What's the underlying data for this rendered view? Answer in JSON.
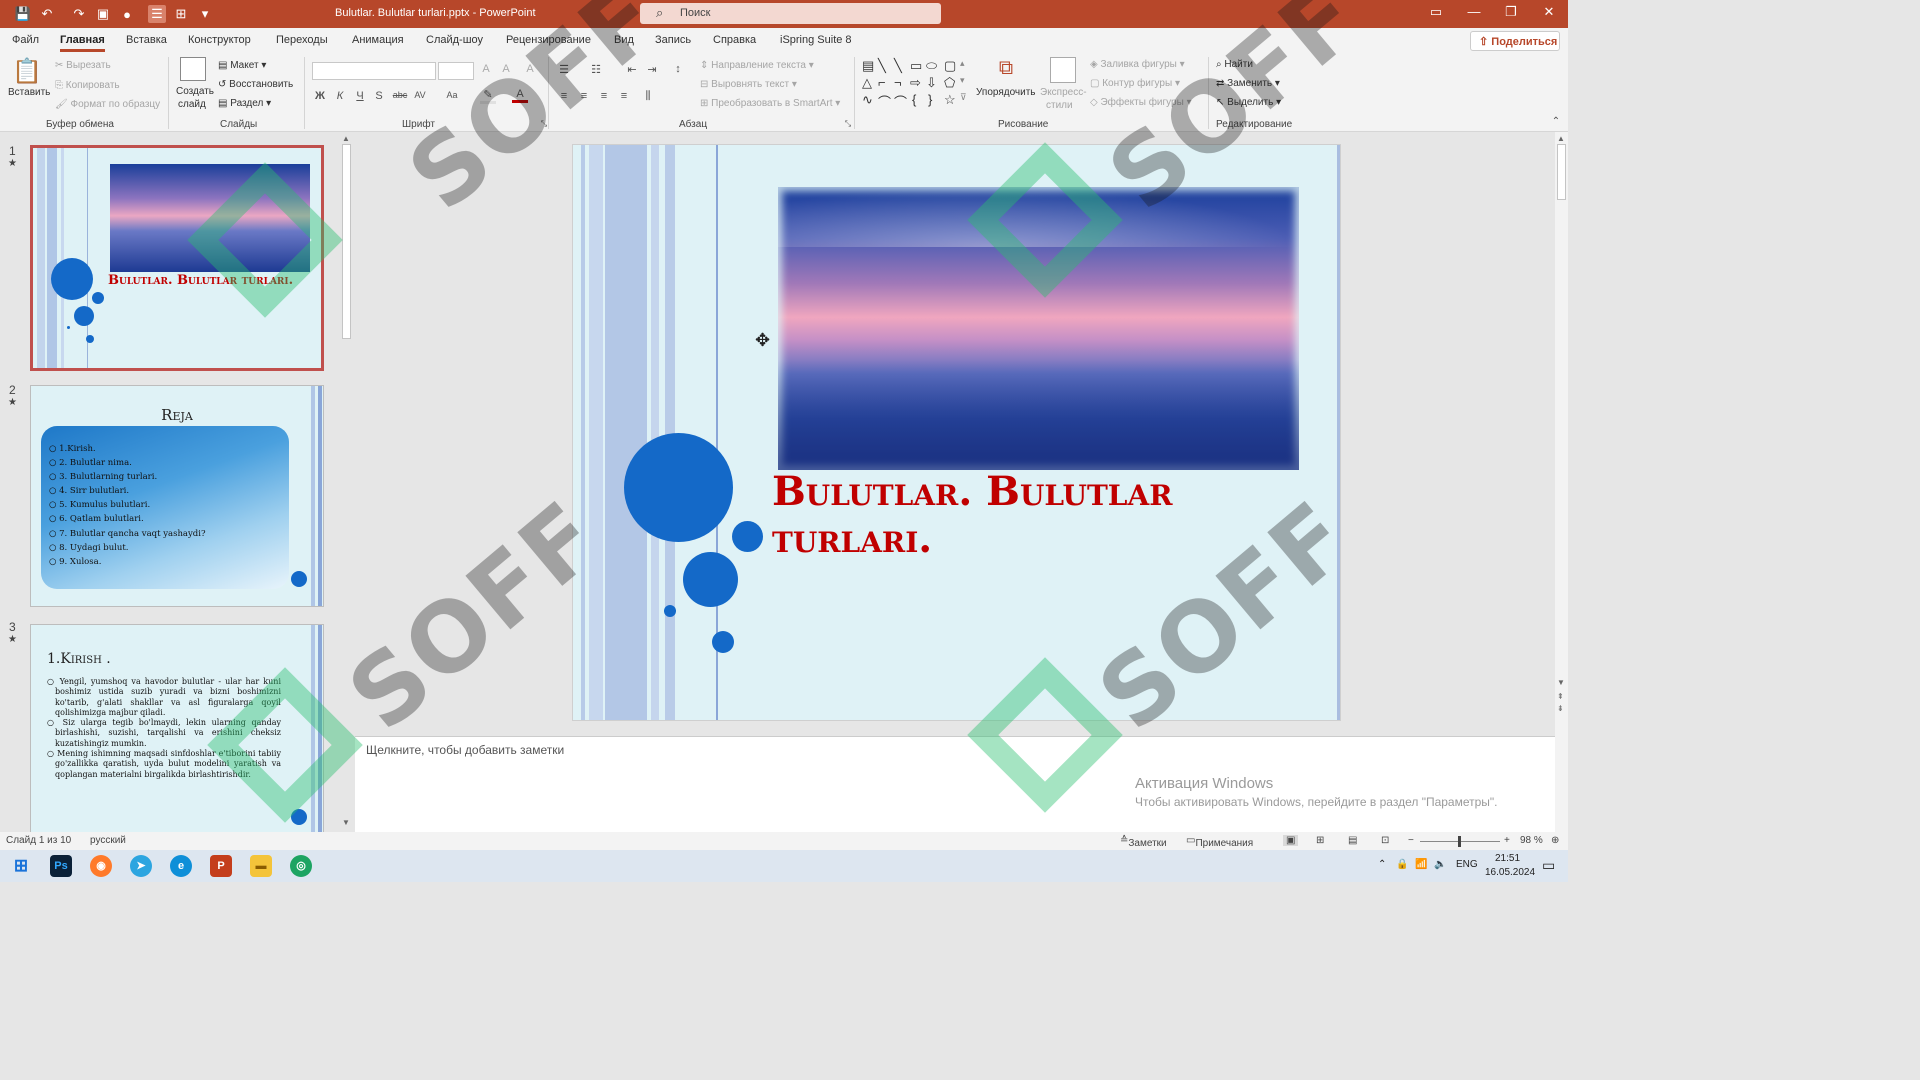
{
  "window": {
    "title": "Bulutlar. Bulutlar turlari.pptx  -  PowerPoint",
    "search_placeholder": "Поиск"
  },
  "menu": [
    "Файл",
    "Главная",
    "Вставка",
    "Конструктор",
    "Переходы",
    "Анимация",
    "Слайд-шоу",
    "Рецензирование",
    "Вид",
    "Запись",
    "Справка",
    "iSpring Suite 8"
  ],
  "share": "Поделиться",
  "ribbon": {
    "clipboard": {
      "paste": "Вставить",
      "cut": "Вырезать",
      "copy": "Копировать",
      "format": "Формат по образцу",
      "group": "Буфер обмена"
    },
    "slides": {
      "new1": "Создать",
      "new2": "слайд",
      "layout": "Макет",
      "reset": "Восстановить",
      "section": "Раздел",
      "group": "Слайды"
    },
    "font": {
      "group": "Шрифт",
      "bold": "Ж",
      "italic": "К",
      "underline": "Ч",
      "shadow": "S",
      "strike": "abc",
      "spacing": "AV",
      "case": "Aa"
    },
    "paragraph": {
      "direction": "Направление текста",
      "align": "Выровнять текст",
      "smartart": "Преобразовать в SmartArt",
      "group": "Абзац"
    },
    "drawing": {
      "arrange": "Упорядочить",
      "styles1": "Экспресс-",
      "styles2": "стили",
      "fill": "Заливка фигуры",
      "outline": "Контур фигуры",
      "effects": "Эффекты фигуры",
      "group": "Рисование"
    },
    "editing": {
      "find": "Найти",
      "replace": "Заменить",
      "select": "Выделить",
      "group": "Редактирование"
    }
  },
  "thumbs": [
    {
      "num": "1",
      "title": "Bulutlar. Bulutlar turlari."
    },
    {
      "num": "2",
      "title": "Reja",
      "items": [
        "1.Kirish.",
        "2. Bulutlar nima.",
        "3. Bulutlarning turlari.",
        "4. Sirr bulutlari.",
        "5. Kumulus bulutlari.",
        "6. Qatlam bulutlari.",
        "7. Bulutlar qancha vaqt yashaydi?",
        "8. Uydagi bulut.",
        "9. Xulosa."
      ]
    },
    {
      "num": "3",
      "title": "1.Kirish .",
      "bullets": [
        "Yengil, yumshoq va havodor bulutlar - ular har kuni boshimiz ustida suzib yuradi va bizni boshimizni ko'tarib, g'alati shakllar va asl figuralarga qoyil qolishimizga majbur qiladi.",
        "Siz ularga tegib bo'lmaydi, lekin ularning qanday birlashishi, suzishi, tarqalishi va erishini cheksiz kuzatishingiz mumkin.",
        "Mening ishimning maqsadi sinfdoshlar e'tiborini tabiiy go'zallikka qaratish, uyda bulut modelini yaratish va qoplangan materialni birgalikda birlashtirishdir."
      ]
    }
  ],
  "slide": {
    "title_line1": "Bulutlar. Bulutlar",
    "title_line2": "turlari."
  },
  "notes_placeholder": "Щелкните, чтобы добавить заметки",
  "activation": {
    "line1": "Активация Windows",
    "line2": "Чтобы активировать Windows, перейдите в раздел \"Параметры\"."
  },
  "status": {
    "slide": "Слайд 1 из 10",
    "lang": "русский",
    "notes": "Заметки",
    "comments": "Примечания",
    "zoom": "98 %"
  },
  "taskbar": {
    "lang": "ENG",
    "time": "21:51",
    "date": "16.05.2024"
  },
  "watermark": "SOFF",
  "colors": {
    "accent": "#b7472a",
    "slide_bg": "#dff2f6",
    "circle": "#1469c8",
    "title_red": "#c00000"
  }
}
